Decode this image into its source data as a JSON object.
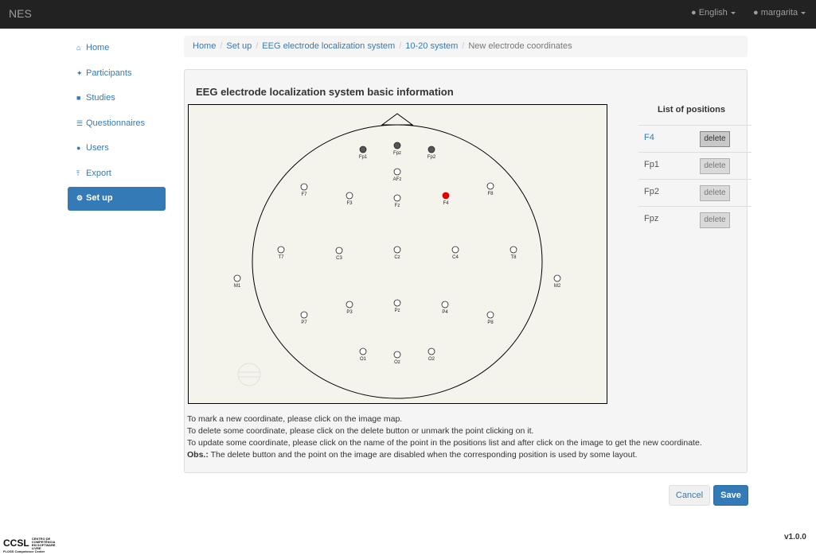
{
  "navbar": {
    "brand": "NES",
    "language": "English",
    "user": "margarita"
  },
  "sidebar": {
    "items": [
      {
        "label": "Home",
        "icon": "home-icon",
        "glyph": "⌂"
      },
      {
        "label": "Participants",
        "icon": "participants-icon",
        "glyph": "✦"
      },
      {
        "label": "Studies",
        "icon": "book-icon",
        "glyph": "■"
      },
      {
        "label": "Questionnaires",
        "icon": "list-icon",
        "glyph": "☰"
      },
      {
        "label": "Users",
        "icon": "user-icon",
        "glyph": "●"
      },
      {
        "label": "Export",
        "icon": "export-icon",
        "glyph": "⤒"
      },
      {
        "label": "Set up",
        "icon": "cog-icon",
        "glyph": "⚙"
      }
    ]
  },
  "breadcrumb": {
    "items": [
      "Home",
      "Set up",
      "EEG electrode localization system",
      "10-20 system"
    ],
    "active": "New electrode coordinates",
    "separator": "/"
  },
  "panel": {
    "title": "EEG electrode localization system basic information",
    "positions_title": "List of positions",
    "positions": [
      {
        "name": "F4",
        "button": "delete"
      },
      {
        "name": "Fp1",
        "button": "delete"
      },
      {
        "name": "Fp2",
        "button": "delete"
      },
      {
        "name": "Fpz",
        "button": "delete"
      }
    ],
    "info": {
      "line1": "To mark a new coordinate, please click on the image map.",
      "line2": "To delete some coordinate, please click on the delete button or unmark the point clicking on it.",
      "line3": "To update some coordinate, please click on the name of the point in the positions list and after click on the image to get the new coordinate.",
      "obs_label": "Obs.:",
      "obs_text": " The delete button and the point on the image are disabled when the corresponding position is used by some layout."
    }
  },
  "electrodes": [
    {
      "label": "Fp1",
      "state": "gray"
    },
    {
      "label": "Fpz",
      "state": "gray"
    },
    {
      "label": "Fp2",
      "state": "gray"
    },
    {
      "label": "AFz",
      "state": "empty"
    },
    {
      "label": "F7",
      "state": "empty"
    },
    {
      "label": "F3",
      "state": "empty"
    },
    {
      "label": "Fz",
      "state": "empty"
    },
    {
      "label": "F4",
      "state": "red"
    },
    {
      "label": "F8",
      "state": "empty"
    },
    {
      "label": "T7",
      "state": "empty"
    },
    {
      "label": "C3",
      "state": "empty"
    },
    {
      "label": "Cz",
      "state": "empty"
    },
    {
      "label": "C4",
      "state": "empty"
    },
    {
      "label": "T8",
      "state": "empty"
    },
    {
      "label": "M1",
      "state": "empty"
    },
    {
      "label": "M2",
      "state": "empty"
    },
    {
      "label": "P7",
      "state": "empty"
    },
    {
      "label": "P3",
      "state": "empty"
    },
    {
      "label": "Pz",
      "state": "empty"
    },
    {
      "label": "P4",
      "state": "empty"
    },
    {
      "label": "P8",
      "state": "empty"
    },
    {
      "label": "O1",
      "state": "empty"
    },
    {
      "label": "Oz",
      "state": "empty"
    },
    {
      "label": "O2",
      "state": "empty"
    }
  ],
  "buttons": {
    "cancel": "Cancel",
    "save": "Save"
  },
  "footer": {
    "logo": "CCSL",
    "logo_small": "CENTRO DE COMPETÊNCIA EM SOFTWARE LIVRE",
    "logo_sub": "FLOSS Competence Center",
    "version": "v1.0.0"
  },
  "colors": {
    "accent": "#337ab7",
    "navbar": "#222222",
    "selected_electrode": "#e00000",
    "used_electrode": "#555555"
  }
}
